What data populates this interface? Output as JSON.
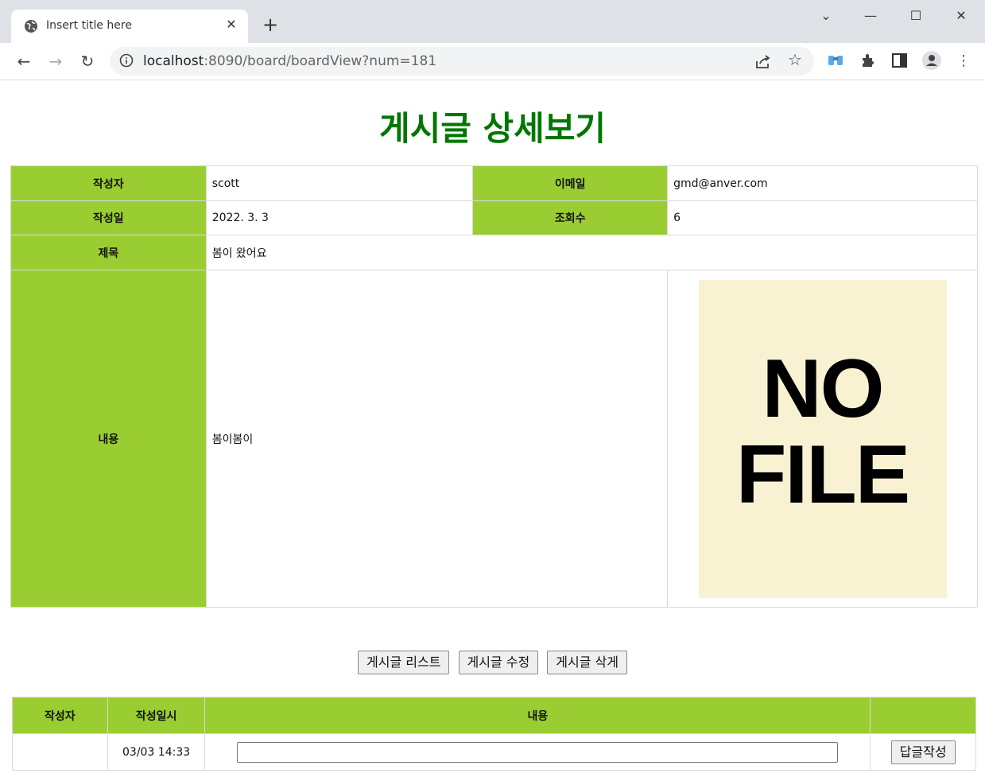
{
  "browser": {
    "tab_title": "Insert title here",
    "url_host": "localhost",
    "url_rest": ":8090/board/boardView?num=181"
  },
  "page": {
    "heading": "게시글 상세보기"
  },
  "detail": {
    "writer_label": "작성자",
    "writer": "scott",
    "email_label": "이메일",
    "email": "gmd@anver.com",
    "date_label": "작성일",
    "date": "2022. 3. 3",
    "views_label": "조회수",
    "views": "6",
    "subject_label": "제목",
    "subject": "봄이 왔어요",
    "content_label": "내용",
    "content": "봄이봄이",
    "image_line1": "NO",
    "image_line2": "FILE"
  },
  "buttons": {
    "list": "게시글 리스트",
    "edit": "게시글 수정",
    "delete": "게시글 삭게"
  },
  "reply": {
    "headers": [
      "작성자",
      "작성일시",
      "내용",
      ""
    ],
    "writer": "",
    "datetime": "03/03 14:33",
    "input_value": "",
    "submit": "답글작성"
  }
}
